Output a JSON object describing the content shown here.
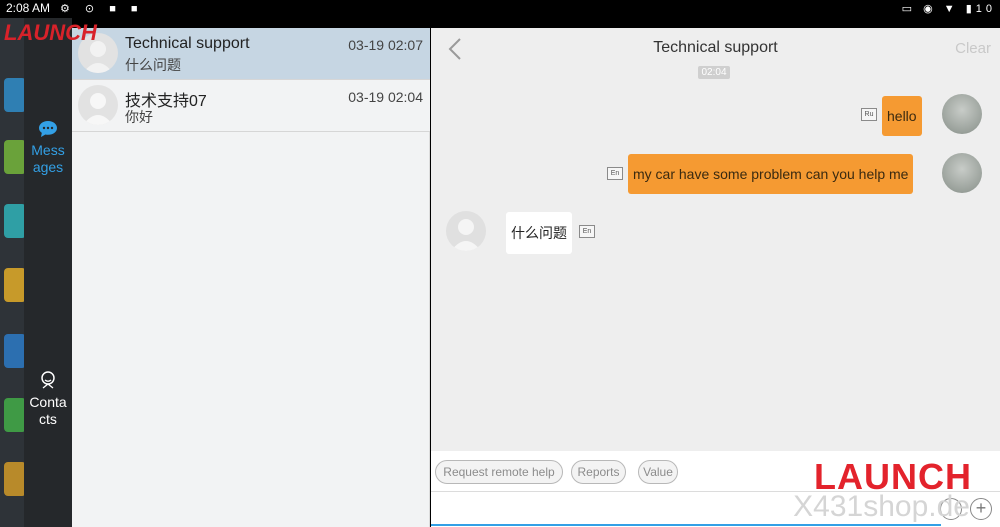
{
  "status_bar": {
    "time": "2:08 AM",
    "battery": "10"
  },
  "brand": {
    "logo": "LAUNCH",
    "watermark_logo": "LAUNCH",
    "watermark_site": "X431shop.de",
    "color": "#d8222a"
  },
  "nav": {
    "messages_label": "Messages",
    "contacts_label": "Contacts",
    "active_color": "#33a0e6"
  },
  "conversations": [
    {
      "name": "Technical support",
      "time": "03-19 02:07",
      "preview": "什么问题",
      "selected": true
    },
    {
      "name": "技术支持07",
      "time": "03-19 02:04",
      "preview": "你好",
      "selected": false
    }
  ],
  "chat": {
    "title": "Technical support",
    "clear_label": "Clear",
    "timestamp": "02:04",
    "messages": [
      {
        "direction": "outgoing",
        "text": "hello",
        "translate_icon": "Ru"
      },
      {
        "direction": "outgoing",
        "text": "my car have some problem can you help me",
        "translate_icon": "En"
      },
      {
        "direction": "incoming",
        "text": "什么问题",
        "translate_icon": "En"
      }
    ],
    "quick_replies": [
      "Request remote help",
      "Reports",
      "Value"
    ],
    "input_value": "",
    "outgoing_bubble_color": "#f59a32"
  }
}
